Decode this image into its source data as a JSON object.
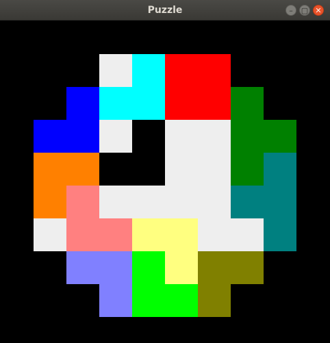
{
  "window": {
    "title": "Puzzle",
    "controls": {
      "minimize_glyph": "–",
      "maximize_glyph": "▢",
      "close_glyph": "✕"
    }
  },
  "board": {
    "background": "#000000",
    "columns": 10,
    "rows": 10,
    "pieces": [
      {
        "name": "white-piece-1",
        "color": "#EEEEEE",
        "cells": [
          [
            3,
            1
          ],
          [
            3,
            2
          ]
        ]
      },
      {
        "name": "cyan-piece",
        "color": "#00FFFF",
        "cells": [
          [
            4,
            1
          ],
          [
            4,
            2
          ],
          [
            3,
            2
          ]
        ]
      },
      {
        "name": "red-piece",
        "color": "#FF0000",
        "cells": [
          [
            5,
            1
          ],
          [
            6,
            1
          ],
          [
            5,
            2
          ],
          [
            6,
            2
          ]
        ]
      },
      {
        "name": "blue-piece",
        "color": "#0000FF",
        "cells": [
          [
            2,
            2
          ],
          [
            1,
            3
          ],
          [
            2,
            3
          ]
        ]
      },
      {
        "name": "white-piece-2",
        "color": "#EEEEEE",
        "cells": [
          [
            3,
            3
          ]
        ]
      },
      {
        "name": "white-piece-3",
        "color": "#EEEEEE",
        "cells": [
          [
            5,
            3
          ],
          [
            6,
            3
          ],
          [
            5,
            4
          ],
          [
            6,
            4
          ],
          [
            3,
            5
          ],
          [
            4,
            5
          ],
          [
            5,
            5
          ],
          [
            6,
            5
          ],
          [
            6,
            6
          ],
          [
            7,
            6
          ]
        ]
      },
      {
        "name": "green-piece",
        "color": "#008000",
        "cells": [
          [
            7,
            2
          ],
          [
            7,
            3
          ],
          [
            8,
            3
          ],
          [
            7,
            4
          ]
        ]
      },
      {
        "name": "teal-piece",
        "color": "#008080",
        "cells": [
          [
            8,
            4
          ],
          [
            7,
            5
          ],
          [
            8,
            5
          ],
          [
            8,
            6
          ]
        ]
      },
      {
        "name": "orange-piece",
        "color": "#FF8000",
        "cells": [
          [
            1,
            4
          ],
          [
            2,
            4
          ],
          [
            1,
            5
          ]
        ]
      },
      {
        "name": "pink-piece",
        "color": "#FF8080",
        "cells": [
          [
            2,
            5
          ],
          [
            2,
            6
          ],
          [
            3,
            6
          ]
        ]
      },
      {
        "name": "white-piece-4",
        "color": "#EEEEEE",
        "cells": [
          [
            1,
            6
          ]
        ]
      },
      {
        "name": "yellow-piece",
        "color": "#FFFF80",
        "cells": [
          [
            4,
            6
          ],
          [
            5,
            6
          ],
          [
            5,
            7
          ]
        ]
      },
      {
        "name": "lavender-piece",
        "color": "#8080FF",
        "cells": [
          [
            2,
            7
          ],
          [
            3,
            7
          ],
          [
            3,
            8
          ]
        ]
      },
      {
        "name": "lime-piece",
        "color": "#00FF00",
        "cells": [
          [
            4,
            7
          ],
          [
            4,
            8
          ],
          [
            5,
            8
          ]
        ]
      },
      {
        "name": "olive-piece",
        "color": "#808000",
        "cells": [
          [
            6,
            7
          ],
          [
            7,
            7
          ],
          [
            6,
            8
          ]
        ]
      }
    ]
  }
}
